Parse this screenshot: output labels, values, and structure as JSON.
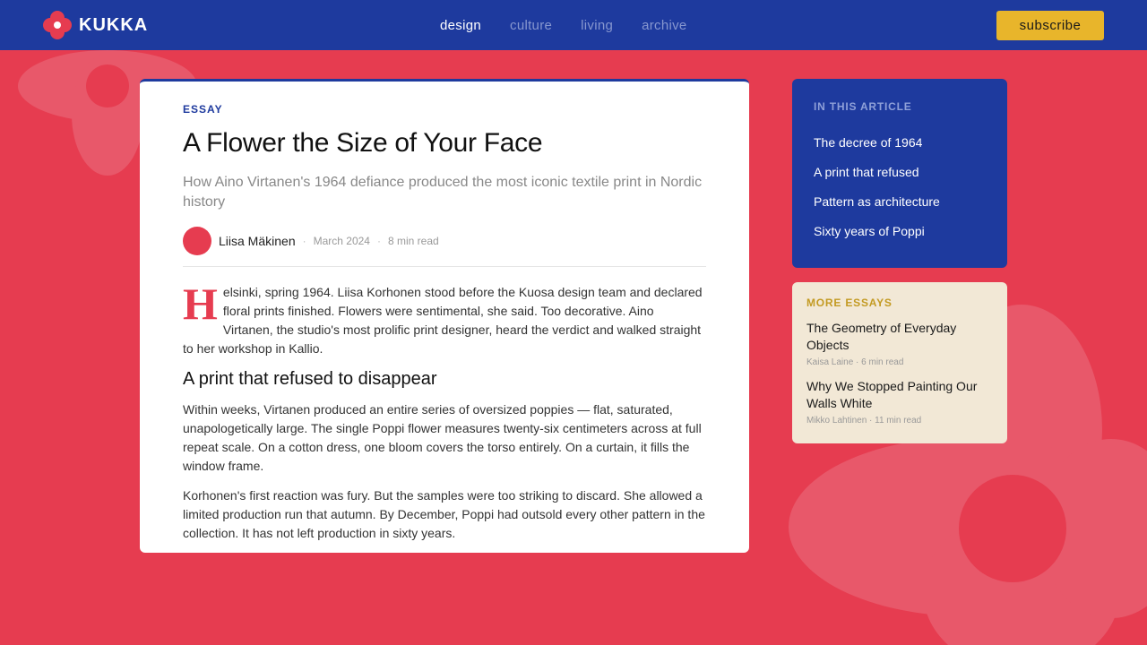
{
  "brand": {
    "name": "KUKKA"
  },
  "nav": {
    "items": [
      {
        "label": "design",
        "active": true
      },
      {
        "label": "culture",
        "active": false
      },
      {
        "label": "living",
        "active": false
      },
      {
        "label": "archive",
        "active": false
      }
    ],
    "subscribe_label": "subscribe"
  },
  "article": {
    "kicker": "ESSAY",
    "title": "A Flower the Size of Your Face",
    "dek": "How Aino Virtanen's 1964 defiance produced the most iconic textile print in Nordic history",
    "author": "Liisa Mäkinen",
    "date": "March 2024",
    "read_time": "8 min read",
    "dropcap": "H",
    "lead": "elsinki, spring 1964. Liisa Korhonen stood before the Kuosa design team and declared floral prints finished. Flowers were sentimental, she said. Too decorative. Aino Virtanen, the studio's most prolific print designer, heard the verdict and walked straight to her workshop in Kallio.",
    "section_heading": "A print that refused to disappear",
    "para2": "Within weeks, Virtanen produced an entire series of oversized poppies — flat, saturated, unapologetically large. The single Poppi flower measures twenty-six centimeters across at full repeat scale. On a cotton dress, one bloom covers the torso entirely. On a curtain, it fills the window frame.",
    "para3": "Korhonen's first reaction was fury. But the samples were too striking to discard. She allowed a limited production run that autumn. By December, Poppi had outsold every other pattern in the collection. It has not left production in sixty years."
  },
  "toc": {
    "title": "IN THIS ARTICLE",
    "items": [
      "The decree of 1964",
      "A print that refused",
      "Pattern as architecture",
      "Sixty years of Poppi"
    ]
  },
  "more": {
    "title": "MORE ESSAYS",
    "essays": [
      {
        "title": "The Geometry of Everyday Objects",
        "meta": "Kaisa Laine · 6 min read"
      },
      {
        "title": "Why We Stopped Painting Our Walls White",
        "meta": "Mikko Lahtinen · 11 min read"
      }
    ]
  },
  "colors": {
    "background": "#e63c50",
    "navy": "#1e3a9e",
    "mustard": "#e8b52b",
    "cream": "#f2e8d6",
    "petal": "#e8586a"
  }
}
